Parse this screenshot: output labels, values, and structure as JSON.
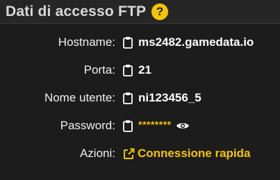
{
  "panel": {
    "title": "Dati di accesso FTP",
    "help_icon_glyph": "?"
  },
  "fields": {
    "hostname": {
      "label": "Hostname:",
      "value": "ms2482.gamedata.io",
      "icon": "clipboard-icon"
    },
    "port": {
      "label": "Porta:",
      "value": "21",
      "icon": "clipboard-icon"
    },
    "username": {
      "label": "Nome utente:",
      "value": "ni123456_5",
      "icon": "clipboard-icon"
    },
    "password": {
      "label": "Password:",
      "value": "********",
      "icon": "clipboard-icon",
      "toggle_icon": "eye-icon"
    }
  },
  "actions": {
    "label": "Azioni:",
    "quick_connect_label": "Connessione rapida",
    "quick_connect_icon": "external-link-icon"
  },
  "colors": {
    "accent": "#f5c400",
    "background": "#1c1c1c",
    "header_background": "#262626",
    "text": "#f2f2f2"
  }
}
